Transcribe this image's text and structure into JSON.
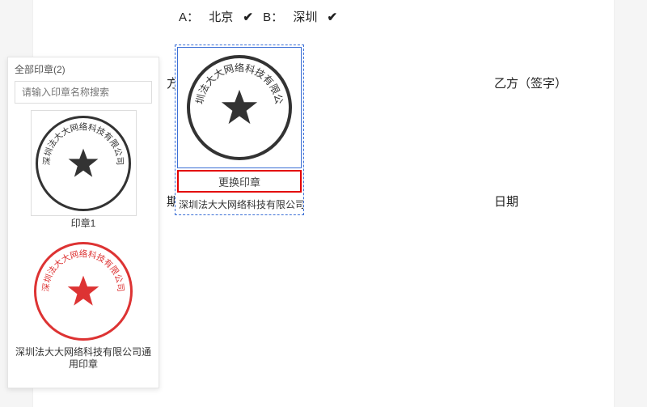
{
  "doc": {
    "choiceA_label": "A：",
    "choiceA_value": "北京",
    "choiceB_label": "B：",
    "choiceB_value": "深圳",
    "check": "✔",
    "partyA_prefix": "方",
    "partyB": "乙方（签字）",
    "dateA": "期",
    "dateB": "日期"
  },
  "placed": {
    "change_label": "更换印章",
    "caption": "深圳法大大网络科技有限公司",
    "ring_text": "深圳法大大网络科技有限公司"
  },
  "panel": {
    "title": "全部印章(2)",
    "search_placeholder": "请输入印章名称搜索",
    "seals": [
      {
        "name": "印章1",
        "ring_text": "深圳法大大网络科技有限公司",
        "color": "dark"
      },
      {
        "name": "深圳法大大网络科技有限公司通用印章",
        "ring_text": "深圳法大大网络科技有限公司",
        "color": "red"
      }
    ]
  }
}
